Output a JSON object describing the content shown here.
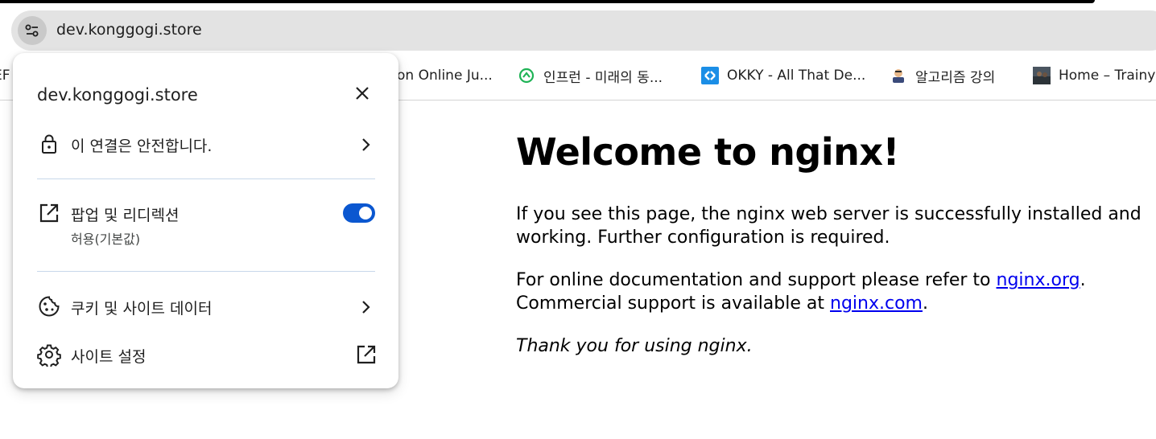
{
  "browser": {
    "url": "dev.konggogi.store"
  },
  "bookmarks": [
    {
      "label": "EF",
      "icon": "bookmark-favicon"
    },
    {
      "label": "on Online Ju...",
      "icon": "none"
    },
    {
      "label": "인프런 - 미래의 동...",
      "icon": "inflearn-favicon"
    },
    {
      "label": "OKKY - All That De...",
      "icon": "okky-favicon"
    },
    {
      "label": "알고리즘 강의",
      "icon": "algorithm-favicon"
    },
    {
      "label": "Home – Trainye",
      "icon": "trainye-favicon"
    }
  ],
  "page": {
    "heading": "Welcome to nginx!",
    "p1": "If you see this page, the nginx web server is successfully installed and working. Further configuration is required.",
    "p2_pre": "For online documentation and support please refer to ",
    "p2_link1": "nginx.org",
    "p2_mid": ".",
    "p2_line2": "Commercial support is available at ",
    "p2_link2": "nginx.com",
    "p2_end": ".",
    "p3": "Thank you for using nginx.",
    "link_color": "#0000ee"
  },
  "site_info_popup": {
    "title": "dev.konggogi.store",
    "connection_label": "이 연결은 안전합니다.",
    "popups_label": "팝업 및 리디렉션",
    "popups_status": "허용(기본값)",
    "popups_enabled": true,
    "cookies_label": "쿠키 및 사이트 데이터",
    "site_settings_label": "사이트 설정",
    "toggle_color": "#0b57d0"
  }
}
